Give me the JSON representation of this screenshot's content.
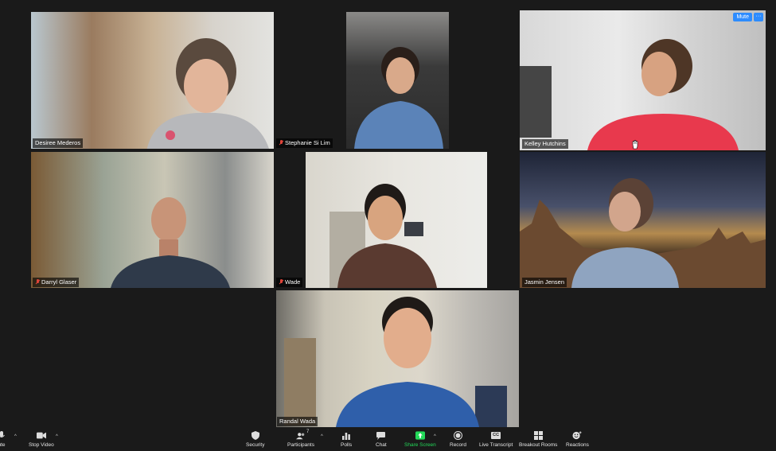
{
  "participants": [
    {
      "name": "Desiree Mederos",
      "muted": false
    },
    {
      "name": "Stephanie Si Lim",
      "muted": true
    },
    {
      "name": "Kelley Hutchins",
      "muted": false,
      "active_speaker": true
    },
    {
      "name": "Darryl Glaser",
      "muted": true
    },
    {
      "name": "Wade",
      "muted": true
    },
    {
      "name": "Jasmin Jensen",
      "muted": false
    },
    {
      "name": "Randal Wada",
      "muted": false
    }
  ],
  "hover_controls": {
    "mute_label": "Mute",
    "more_label": "···"
  },
  "toolbar": {
    "mute_label": "ute",
    "stop_video_label": "Stop Video",
    "security_label": "Security",
    "participants_label": "Participants",
    "participants_count": "7",
    "polls_label": "Polls",
    "chat_label": "Chat",
    "share_screen_label": "Share Screen",
    "record_label": "Record",
    "live_transcript_label": "Live Transcript",
    "live_transcript_icon_text": "CC",
    "breakout_rooms_label": "Breakout Rooms",
    "reactions_label": "Reactions"
  },
  "colors": {
    "active_border": "#c9dc6b",
    "share_green": "#23d959",
    "mute_blue": "#2d8cff",
    "muted_red": "#e0453a"
  }
}
